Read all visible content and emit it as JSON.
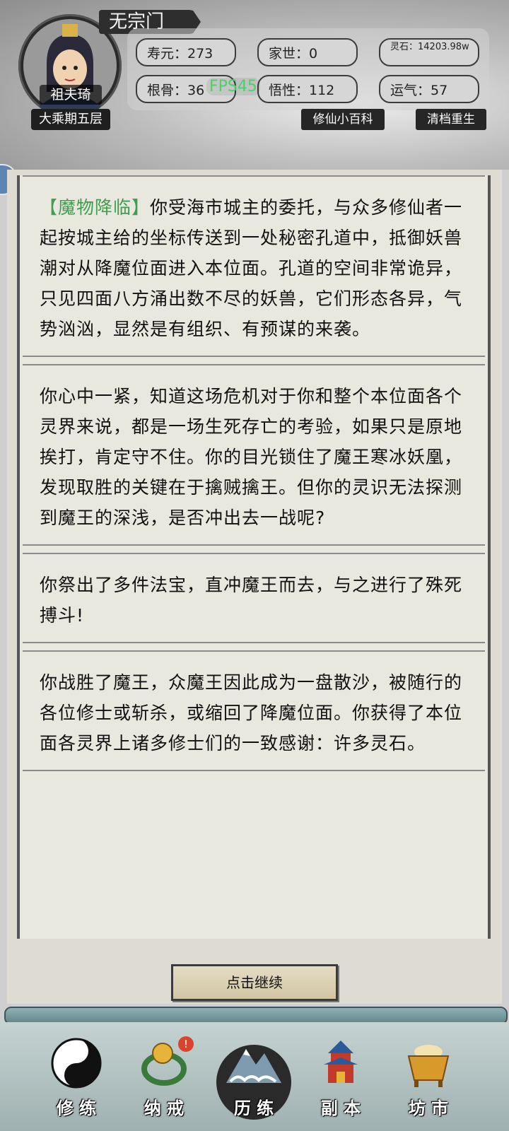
{
  "header": {
    "sect_name": "无宗门",
    "avatar_name": "祖夫琦",
    "realm": "大乘期五层",
    "fps": "FPS45",
    "stats": {
      "lifespan": "寿元：273",
      "family": "家世：0",
      "spirit_stone": "灵石：14203.98w",
      "root": "根骨：36",
      "comprehension": "悟性：112",
      "luck": "运气：57"
    },
    "wiki_button": "修仙小百科",
    "reset_button": "清档重生"
  },
  "events": [
    {
      "tag": "【魔物降临】",
      "text": "你受海市城主的委托，与众多修仙者一起按城主给的坐标传送到一处秘密孔道中，抵御妖兽潮对从降魔位面进入本位面。孔道的空间非常诡异，只见四面八方涌出数不尽的妖兽，它们形态各异，气势汹汹，显然是有组织、有预谋的来袭。"
    },
    {
      "tag": "",
      "text": "你心中一紧，知道这场危机对于你和整个本位面各个灵界来说，都是一场生死存亡的考验，如果只是原地挨打，肯定守不住。你的目光锁住了魔王寒冰妖凰，发现取胜的关键在于擒贼擒王。但你的灵识无法探测到魔王的深浅，是否冲出去一战呢?"
    },
    {
      "tag": "",
      "text": "你祭出了多件法宝，直冲魔王而去，与之进行了殊死搏斗!"
    },
    {
      "tag": "",
      "text": "你战胜了魔王，众魔王因此成为一盘散沙，被随行的各位修士或斩杀，或缩回了降魔位面。你获得了本位面各灵界上诸多修士们的一致感谢：许多灵石。"
    }
  ],
  "continue_button": "点击继续",
  "nav": {
    "items": [
      {
        "label": "修 练",
        "icon": "taiji-icon"
      },
      {
        "label": "纳 戒",
        "icon": "ring-icon",
        "badge": "!"
      },
      {
        "label": "历 练",
        "icon": "mountain-icon",
        "active": true
      },
      {
        "label": "副 本",
        "icon": "pagoda-icon"
      },
      {
        "label": "坊 市",
        "icon": "cauldron-icon"
      }
    ]
  },
  "colors": {
    "tag_green": "#3f9e4f",
    "fps_green": "#4cd06a",
    "badge_red": "#d9442e"
  }
}
